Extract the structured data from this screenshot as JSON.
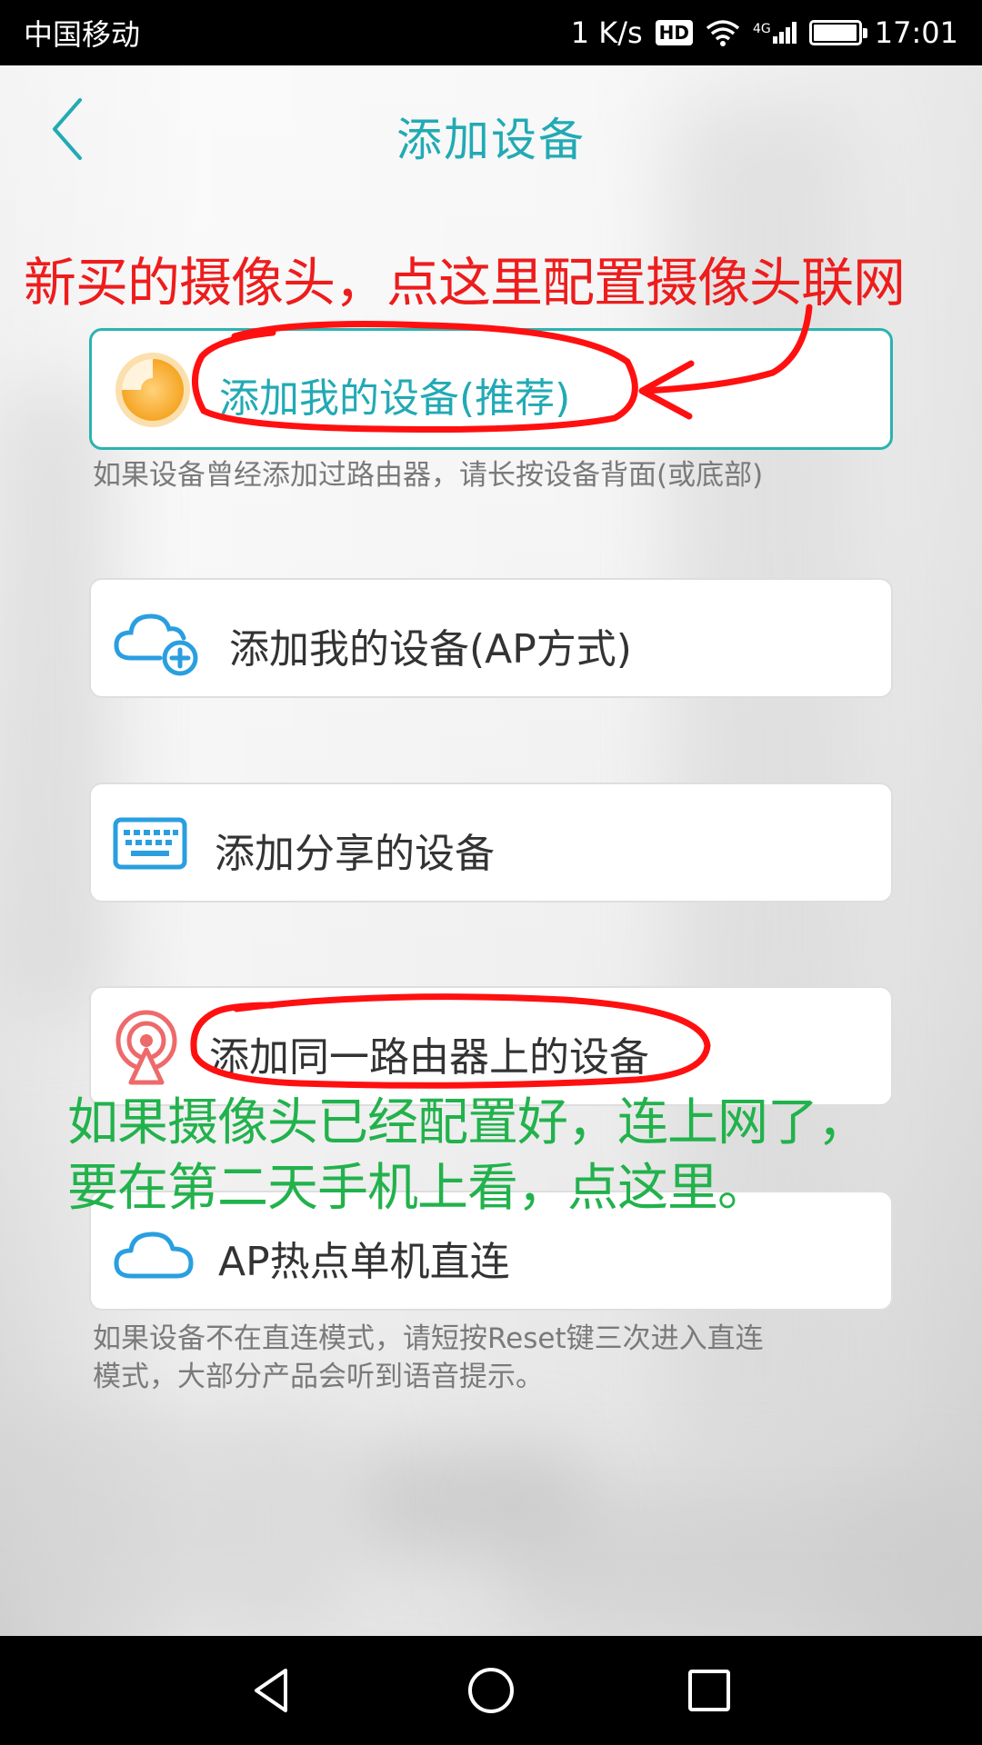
{
  "status_bar": {
    "carrier": "中国移动",
    "net_speed": "1 K/s",
    "hd_badge": "HD",
    "network_type": "4G",
    "battery_level": 0.9,
    "time": "17:01"
  },
  "header": {
    "title": "添加设备"
  },
  "annotations": {
    "top_red": "新买的摄像头，点这里配置摄像头联网",
    "middle_green_line1": "如果摄像头已经配置好，连上网了，",
    "middle_green_line2": "要在第二天手机上看，点这里。",
    "colors": {
      "red": "#ee1c1c",
      "green": "#22b24c"
    }
  },
  "options": [
    {
      "label": "添加我的设备(推荐)",
      "icon": "orange-circle-icon",
      "hint": "如果设备曾经添加过路由器，请长按设备背面(或底部)"
    },
    {
      "label": "添加我的设备(AP方式)",
      "icon": "cloud-add-icon"
    },
    {
      "label": "添加分享的设备",
      "icon": "keyboard-icon"
    },
    {
      "label": "添加同一路由器上的设备",
      "icon": "radar-signal-icon"
    },
    {
      "label": "AP热点单机直连",
      "icon": "cloud-icon",
      "hint_line1": "如果设备不在直连模式，请短按Reset键三次进入直连",
      "hint_line2": "模式，大部分产品会听到语音提示。"
    }
  ],
  "colors": {
    "accent": "#22aab4",
    "card_border_primary": "#2cb3b0",
    "icon_blue": "#2a9fdf"
  }
}
